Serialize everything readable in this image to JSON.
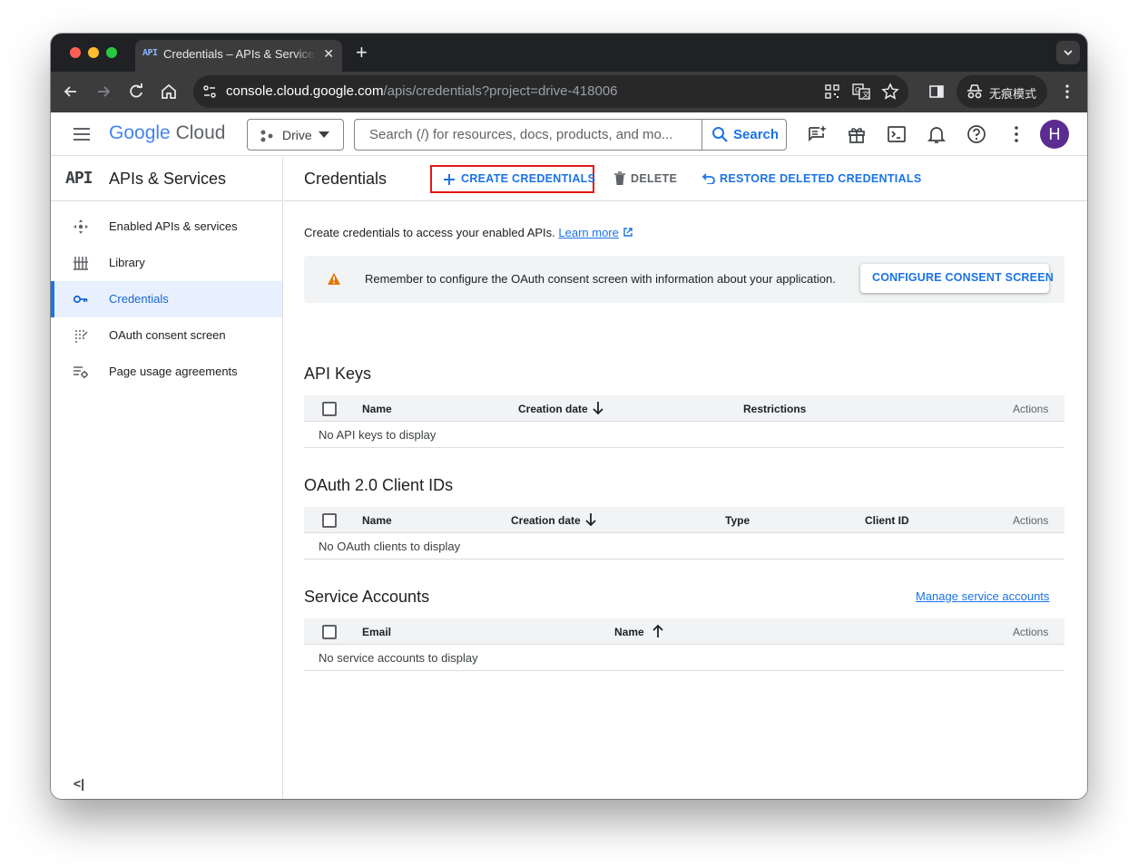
{
  "browser": {
    "tab_title": "Credentials – APIs & Services",
    "tab_favicon": "API",
    "url_host": "console.cloud.google.com",
    "url_path": "/apis/credentials?project=drive-418006",
    "incognito_label": "无痕模式"
  },
  "header": {
    "logo_google": "Google",
    "logo_cloud": "Cloud",
    "project": "Drive",
    "search_placeholder": "Search (/) for resources, docs, products, and mo...",
    "search_button": "Search",
    "avatar_letter": "H"
  },
  "sidebar": {
    "badge": "API",
    "title": "APIs & Services",
    "items": [
      {
        "label": "Enabled APIs & services",
        "icon": "hub-icon"
      },
      {
        "label": "Library",
        "icon": "library-icon"
      },
      {
        "label": "Credentials",
        "icon": "key-icon",
        "active": true
      },
      {
        "label": "OAuth consent screen",
        "icon": "consent-icon"
      },
      {
        "label": "Page usage agreements",
        "icon": "settings-list-icon"
      }
    ],
    "collapse_icon": "collapse-sidebar-icon"
  },
  "main": {
    "title": "Credentials",
    "actions": {
      "create": "CREATE CREDENTIALS",
      "delete": "DELETE",
      "restore": "RESTORE DELETED CREDENTIALS"
    },
    "intro": "Create credentials to access your enabled APIs.",
    "learn_more": "Learn more",
    "banner": {
      "text": "Remember to configure the OAuth consent screen with information about your application.",
      "button": "CONFIGURE CONSENT SCREEN"
    },
    "api_keys": {
      "title": "API Keys",
      "columns": [
        "Name",
        "Creation date",
        "Restrictions",
        "Actions"
      ],
      "empty": "No API keys to display"
    },
    "oauth": {
      "title": "OAuth 2.0 Client IDs",
      "columns": [
        "Name",
        "Creation date",
        "Type",
        "Client ID",
        "Actions"
      ],
      "empty": "No OAuth clients to display"
    },
    "service_accounts": {
      "title": "Service Accounts",
      "manage_link": "Manage service accounts",
      "columns": [
        "Email",
        "Name",
        "Actions"
      ],
      "empty": "No service accounts to display"
    }
  },
  "colors": {
    "accent": "#1a73e8",
    "highlight_border": "#e41515",
    "warning": "#e37400",
    "avatar": "#5c2d91"
  }
}
